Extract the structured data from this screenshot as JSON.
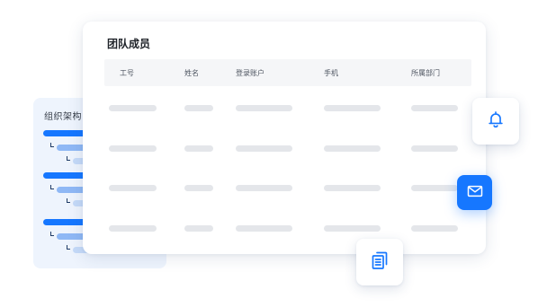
{
  "org_panel": {
    "title": "组织架构"
  },
  "team_card": {
    "title": "团队成员",
    "columns": [
      "工号",
      "姓名",
      "登录账户",
      "手机",
      "所属部门"
    ],
    "placeholder_rows": 4
  },
  "icons": {
    "notification": "bell-icon",
    "message": "mail-icon",
    "documents": "copy-documents-icon"
  },
  "colors": {
    "accent": "#1677ff",
    "accent_light": "#8fb8f5",
    "panel_bg": "#eef4fd",
    "skeleton": "#e4e6ea"
  }
}
